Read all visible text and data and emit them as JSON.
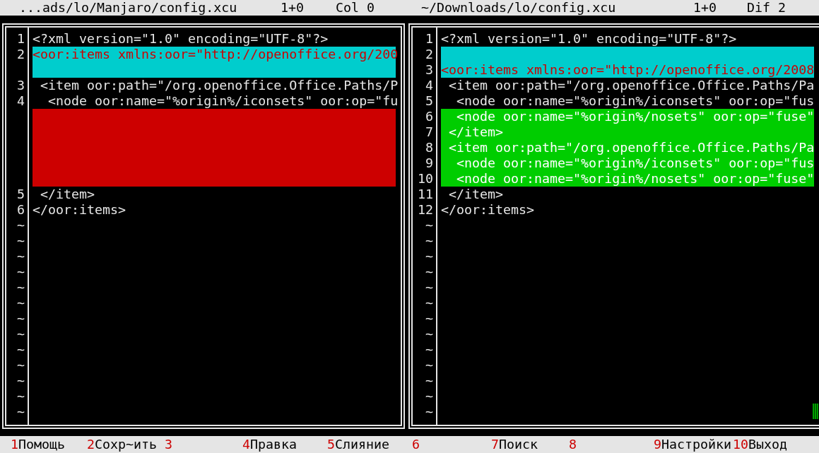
{
  "headers": [
    {
      "path": "...ads/lo/Manjaro/config.xcu",
      "position": "1+0",
      "info": "Col 0"
    },
    {
      "path": "~/Downloads/lo/config.xcu",
      "position": "1+0",
      "info": "Dif 2"
    }
  ],
  "panels": [
    {
      "lines": [
        {
          "kind": "same",
          "number": "1",
          "text": "<?xml version=\"1.0\" encoding=\"UTF-8\"?>"
        },
        {
          "kind": "changed",
          "number": "2",
          "text": "<oor:items xmlns:oor=\"http://openoffice.org/200"
        },
        {
          "kind": "changed"
        },
        {
          "kind": "same",
          "number": "3",
          "text": " <item oor:path=\"/org.openoffice.Office.Paths/P"
        },
        {
          "kind": "same",
          "number": "4",
          "text": "  <node oor:name=\"%origin%/iconsets\" oor:op=\"fu"
        },
        {
          "kind": "removed"
        },
        {
          "kind": "removed"
        },
        {
          "kind": "removed"
        },
        {
          "kind": "removed"
        },
        {
          "kind": "removed"
        },
        {
          "kind": "same",
          "number": "5",
          "text": " </item>"
        },
        {
          "kind": "same",
          "number": "6",
          "text": "</oor:items>"
        }
      ],
      "tildes": [
        "~",
        "~",
        "~",
        "~",
        "~",
        "~",
        "~",
        "~",
        "~",
        "~",
        "~",
        "~",
        "~"
      ]
    },
    {
      "lines": [
        {
          "kind": "same",
          "number": "1",
          "text": "<?xml version=\"1.0\" encoding=\"UTF-8\"?>"
        },
        {
          "kind": "changed",
          "number": "2"
        },
        {
          "kind": "changed",
          "number": "3",
          "text": "<oor:items xmlns:oor=\"http://openoffice.org/2008"
        },
        {
          "kind": "same",
          "number": "4",
          "text": " <item oor:path=\"/org.openoffice.Office.Paths/Pa"
        },
        {
          "kind": "same",
          "number": "5",
          "text": "  <node oor:name=\"%origin%/iconsets\" oor:op=\"fus"
        },
        {
          "kind": "added",
          "number": "6",
          "text": "  <node oor:name=\"%origin%/nosets\" oor:op=\"fuse\""
        },
        {
          "kind": "added",
          "number": "7",
          "text": " </item>"
        },
        {
          "kind": "added",
          "number": "8",
          "text": " <item oor:path=\"/org.openoffice.Office.Paths/Pa"
        },
        {
          "kind": "added",
          "number": "9",
          "text": "  <node oor:name=\"%origin%/iconsets\" oor:op=\"fus"
        },
        {
          "kind": "added",
          "number": "10",
          "text": "  <node oor:name=\"%origin%/nosets\" oor:op=\"fuse\""
        },
        {
          "kind": "same",
          "number": "11",
          "text": " </item>"
        },
        {
          "kind": "same",
          "number": "12",
          "text": "</oor:items>"
        }
      ],
      "tildes": [
        "~",
        "~",
        "~",
        "~",
        "~",
        "~",
        "~",
        "~",
        "~",
        "~",
        "~",
        "~",
        "~"
      ]
    }
  ],
  "function_keys": [
    {
      "number": "1",
      "label": "Помощь"
    },
    {
      "number": "2",
      "label": "Сохр~ить"
    },
    {
      "number": "3"
    },
    {
      "number": "4",
      "label": "Правка"
    },
    {
      "number": "5",
      "label": "Слияние"
    },
    {
      "number": "6"
    },
    {
      "number": "7",
      "label": "Поиск"
    },
    {
      "number": "8"
    },
    {
      "number": "9",
      "label": "Настройки"
    },
    {
      "number": "10",
      "label": "Выход"
    }
  ]
}
